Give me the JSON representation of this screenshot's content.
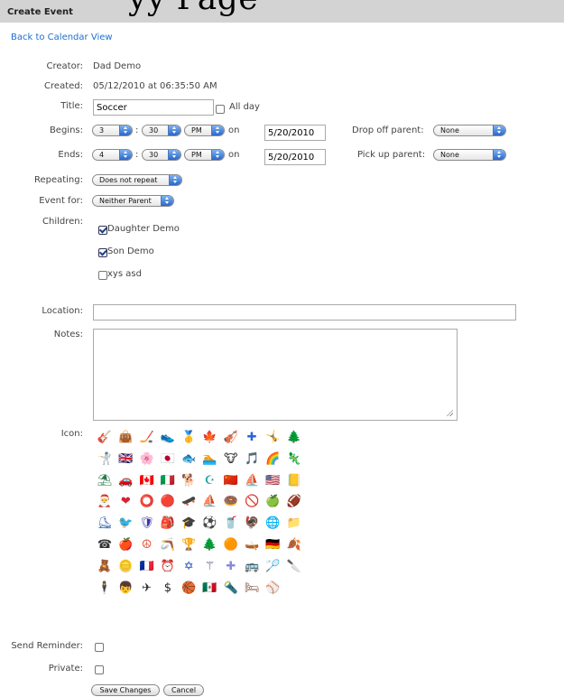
{
  "header": {
    "title": "Create Event",
    "overlay_text": "yy Page"
  },
  "back_link": "Back to Calendar View",
  "creator": {
    "label": "Creator:",
    "value": "Dad Demo"
  },
  "created": {
    "label": "Created:",
    "value": "05/12/2010 at 06:35:50 AM"
  },
  "title_field": {
    "label": "Title:",
    "value": "Soccer",
    "allday_label": "All day"
  },
  "begins": {
    "label": "Begins:",
    "hour": "3",
    "minute": "30",
    "ampm": "PM",
    "on_label": "on",
    "date": "5/20/2010"
  },
  "ends": {
    "label": "Ends:",
    "hour": "4",
    "minute": "30",
    "ampm": "PM",
    "on_label": "on",
    "date": "5/20/2010"
  },
  "colon": ":",
  "drop_off_parent": {
    "label": "Drop off parent:",
    "value": "None"
  },
  "pick_up_parent": {
    "label": "Pick up parent:",
    "value": "None"
  },
  "repeating": {
    "label": "Repeating:",
    "value": "Does not repeat"
  },
  "event_for": {
    "label": "Event for:",
    "value": "Neither Parent"
  },
  "children": {
    "label": "Children:",
    "items": [
      {
        "name": "Daughter Demo",
        "checked": true
      },
      {
        "name": "Son Demo",
        "checked": true
      },
      {
        "name": "xys asd",
        "checked": false
      }
    ]
  },
  "location": {
    "label": "Location:",
    "value": ""
  },
  "notes": {
    "label": "Notes:",
    "value": ""
  },
  "icon": {
    "label": "Icon:",
    "rows": [
      [
        "🎸",
        "👜",
        "🏒",
        "👟",
        "🥇",
        "🍁",
        "🎻",
        "✚",
        "🤸",
        "🌲"
      ],
      [
        "🤺",
        "🇬🇧",
        "🌸",
        "🇯🇵",
        "🐟",
        "🏊",
        "🐮",
        "🎵",
        "🌈",
        "🦎"
      ],
      [
        "⛱",
        "🚗",
        "🇨🇦",
        "🇮🇹",
        "🐕",
        "☪",
        "🇨🇳",
        "⛵",
        "🇺🇸",
        "📒"
      ],
      [
        "🎅",
        "❤",
        "⭕",
        "🔴",
        "🛹",
        "⛵",
        "🍩",
        "🚫",
        "🍏",
        "🏈"
      ],
      [
        "⛸",
        "🐦",
        "🛡",
        "🎒",
        "🎓",
        "⚽",
        "🥤",
        "🦃",
        "🌐",
        "📁"
      ],
      [
        "☎",
        "🍎",
        "☮",
        "🪃",
        "🏆",
        "🌲",
        "🟠",
        "🛶",
        "🇩🇪",
        "🍂"
      ],
      [
        "🧸",
        "🪙",
        "🇫🇷",
        "⏰",
        "✡",
        "⚚",
        "✚",
        "🚌",
        "🏸",
        "🔪"
      ],
      [
        "🕴",
        "👦",
        "✈",
        "$",
        "🏀",
        "🇲🇽",
        "🔦",
        "🛏",
        "⚾"
      ]
    ],
    "colors": [
      [
        "#7a4a2a",
        "#3b6fa0",
        "#2d4f8a",
        "#1a1a1a",
        "#c78a1c",
        "#d0501a",
        "#8a3a1a",
        "#2a64d8",
        "#333333",
        "#3a7a3a"
      ],
      [
        "#222222",
        "#c8102e",
        "#e54f8f",
        "#d22030",
        "#2a9bc8",
        "#2a5fb8",
        "#222222",
        "#555555",
        "#d84090",
        "#c06020"
      ],
      [
        "#2a7a4a",
        "#aa2020",
        "#d22030",
        "#1a9a4a",
        "#222222",
        "#1aa0a0",
        "#d82020",
        "#333333",
        "#2030a0",
        "#9a7a20"
      ],
      [
        "#c83a2a",
        "#d82030",
        "#2a3a2a",
        "#d84040",
        "#222222",
        "#3a5a9a",
        "#d06a4a",
        "#c83030",
        "#7ac82a",
        "#8a4a2a"
      ],
      [
        "#2a5aa8",
        "#8a3a3a",
        "#3a3aa0",
        "#2a3a5a",
        "#222222",
        "#222222",
        "#3a7a3a",
        "#a04a1a",
        "#2aa04a",
        "#e8a020"
      ],
      [
        "#333333",
        "#c83a1a",
        "#e04a2a",
        "#3a5aa8",
        "#6a6a6a",
        "#2a4ad8",
        "#e8a020",
        "#3a8ad8",
        "#d82020",
        "#8a4a2a"
      ],
      [
        "#3a5ac8",
        "#c89a2a",
        "#2030a0",
        "#333333",
        "#1a4ab8",
        "#3a4a6a",
        "#8a8ad8",
        "#d8a020",
        "#3a6a3a",
        "#8a4a2a"
      ],
      [
        "#2a4ad8",
        "#8a5a3a",
        "#333333",
        "#222222",
        "#c86a1a",
        "#2a9a4a",
        "#333333",
        "#7a4a3a",
        "#aaaaaa"
      ]
    ]
  },
  "send_reminder": {
    "label": "Send Reminder:",
    "checked": false
  },
  "private": {
    "label": "Private:",
    "checked": false
  },
  "buttons": {
    "save": "Save Changes",
    "cancel": "Cancel"
  }
}
